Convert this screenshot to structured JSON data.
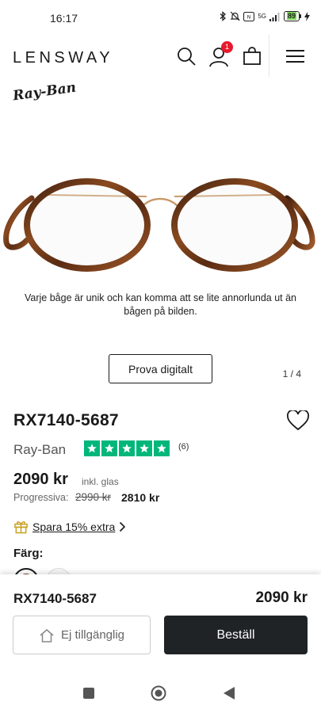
{
  "status_bar": {
    "time": "16:17",
    "network": "5G",
    "battery": "89",
    "icons": [
      "bluetooth-icon",
      "mute-icon",
      "nfc-icon",
      "signal-icon",
      "battery-icon"
    ]
  },
  "header": {
    "logo": "LENSWAY",
    "cart_count": "1",
    "icons": [
      "search-icon",
      "account-icon",
      "bag-icon",
      "menu-icon"
    ]
  },
  "brand_logo": "Ray-Ban",
  "gallery": {
    "disclaimer": "Varje båge är unik och kan komma att se lite annorlunda ut än bågen på bilden.",
    "try_on_label": "Prova digitalt",
    "pager": "1 / 4"
  },
  "product": {
    "title": "RX7140-5687",
    "brand": "Ray-Ban",
    "review_count": "(6)",
    "rating_stars": 5,
    "price": "2090 kr",
    "price_note": "inkl. glas",
    "progressive_label": "Progressiva:",
    "progressive_old_price": "2990 kr",
    "progressive_new_price": "2810 kr",
    "promo": "Spara 15% extra",
    "color_label": "Färg:"
  },
  "sticky_bar": {
    "title": "RX7140-5687",
    "price": "2090 kr",
    "unavailable_label": "Ej tillgänglig",
    "order_label": "Beställ"
  },
  "colors": {
    "trustpilot_green": "#00b67a",
    "badge_red": "#e8192c",
    "button_dark": "#1f2326",
    "promo_gold": "#c9a227"
  }
}
